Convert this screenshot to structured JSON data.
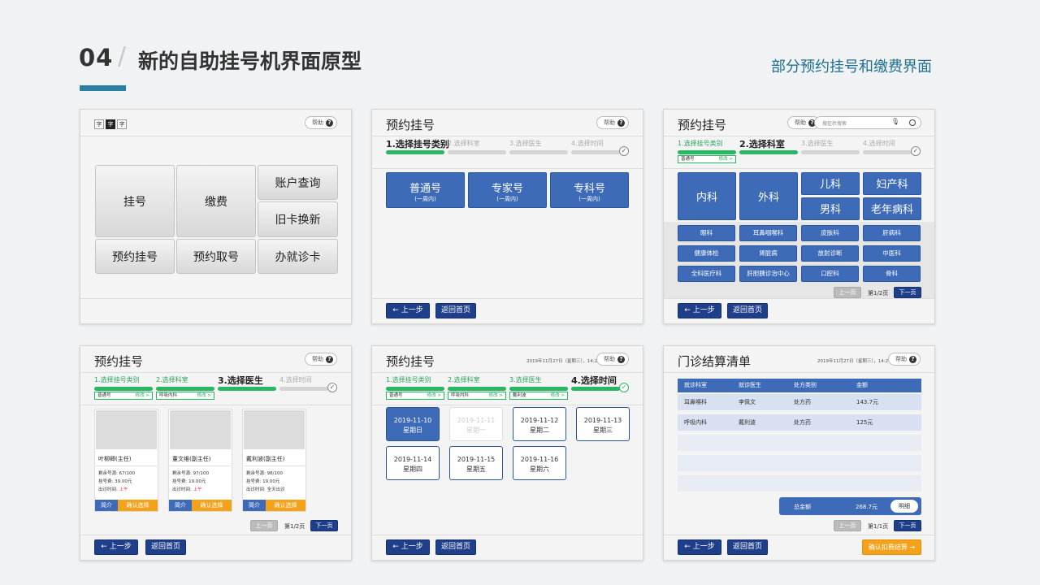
{
  "header": {
    "number": "04",
    "slash": "/",
    "title": "新的自助挂号机界面原型",
    "subtitle": "部分预约挂号和缴费界面"
  },
  "common": {
    "help": "帮助",
    "help_icon": "?",
    "back": "上一步",
    "home": "返回首页",
    "prev_page": "上一页",
    "next_page": "下一页",
    "modify": "修改 >",
    "check_icon": "✓",
    "back_arrow": "←"
  },
  "panel1": {
    "font_sizes": [
      "字",
      "字",
      "字"
    ],
    "buttons": [
      "挂号",
      "缴费",
      "账户查询",
      "旧卡换新",
      "预约挂号",
      "预约取号",
      "办就诊卡"
    ]
  },
  "panel2": {
    "title": "预约挂号",
    "steps": [
      "1.选择挂号类别",
      "2.选择科室",
      "3.选择医生",
      "4.选择时间"
    ],
    "types": [
      {
        "name": "普通号",
        "note": "(一周内)"
      },
      {
        "name": "专家号",
        "note": "(一周内)"
      },
      {
        "name": "专科号",
        "note": "(一周内)"
      }
    ]
  },
  "panel3": {
    "title": "预约挂号",
    "search_placeholder": "搜症状搜索",
    "steps": [
      "1.选择挂号类别",
      "2.选择科室",
      "3.选择医生",
      "4.选择时间"
    ],
    "sel1": "普通号",
    "big_depts": [
      "内科",
      "外科",
      "儿科",
      "妇产科",
      "男科",
      "老年病科"
    ],
    "depts": [
      "眼科",
      "耳鼻咽喉科",
      "皮肤科",
      "肝病科",
      "健康体检",
      "肾脏病",
      "放射诊断",
      "中医科",
      "全科医疗科",
      "肝胆胰诊治中心",
      "口腔科",
      "骨科"
    ],
    "page": "第1/2页"
  },
  "panel4": {
    "title": "预约挂号",
    "steps": [
      "1.选择挂号类别",
      "2.选择科室",
      "3.选择医生",
      "4.选择时间"
    ],
    "sel1": "普通号",
    "sel2": "呼吸内科",
    "doctors": [
      {
        "name": "叶柳卿(主任)",
        "remain": "剩余号源: 67/100",
        "fee": "挂号费: 39.00元",
        "time": "出诊时间:",
        "time_val": "上午"
      },
      {
        "name": "董文维(副主任)",
        "remain": "剩余号源: 97/100",
        "fee": "挂号费: 19.00元",
        "time": "出诊时间:",
        "time_val": "上午"
      },
      {
        "name": "戴利波(副主任)",
        "remain": "剩余号源: 98/100",
        "fee": "挂号费: 19.00元",
        "time": "出诊时间: 全天出诊",
        "time_val": ""
      }
    ],
    "intro": "简介",
    "confirm": "确认选择",
    "page": "第1/2页"
  },
  "panel5": {
    "title": "预约挂号",
    "datetime": "2019年11月27日（星期三），14:29",
    "steps": [
      "1.选择挂号类别",
      "2.选择科室",
      "3.选择医生",
      "4.选择时间"
    ],
    "sel1": "普通号",
    "sel2": "呼吸内科",
    "sel3": "戴利波",
    "dates": [
      {
        "date": "2019-11-10",
        "day": "星期日"
      },
      {
        "date": "2019-11-11",
        "day": "星期一"
      },
      {
        "date": "2019-11-12",
        "day": "星期二"
      },
      {
        "date": "2019-11-13",
        "day": "星期三"
      },
      {
        "date": "2019-11-14",
        "day": "星期四"
      },
      {
        "date": "2019-11-15",
        "day": "星期五"
      },
      {
        "date": "2019-11-16",
        "day": "星期六"
      }
    ]
  },
  "panel6": {
    "title": "门诊结算清单",
    "datetime": "2019年11月27日（星期三），14:29",
    "columns": [
      "就诊科室",
      "就诊医生",
      "处方类别",
      "金额"
    ],
    "rows": [
      [
        "耳鼻喉科",
        "李佩文",
        "处方药",
        "143.7元"
      ],
      [
        "呼吸内科",
        "戴利波",
        "处方药",
        "125元"
      ]
    ],
    "total_label": "总金额",
    "total": "268.7元",
    "detail": "明细",
    "page": "第1/1页",
    "confirm_pay": "确认扣费结算"
  }
}
